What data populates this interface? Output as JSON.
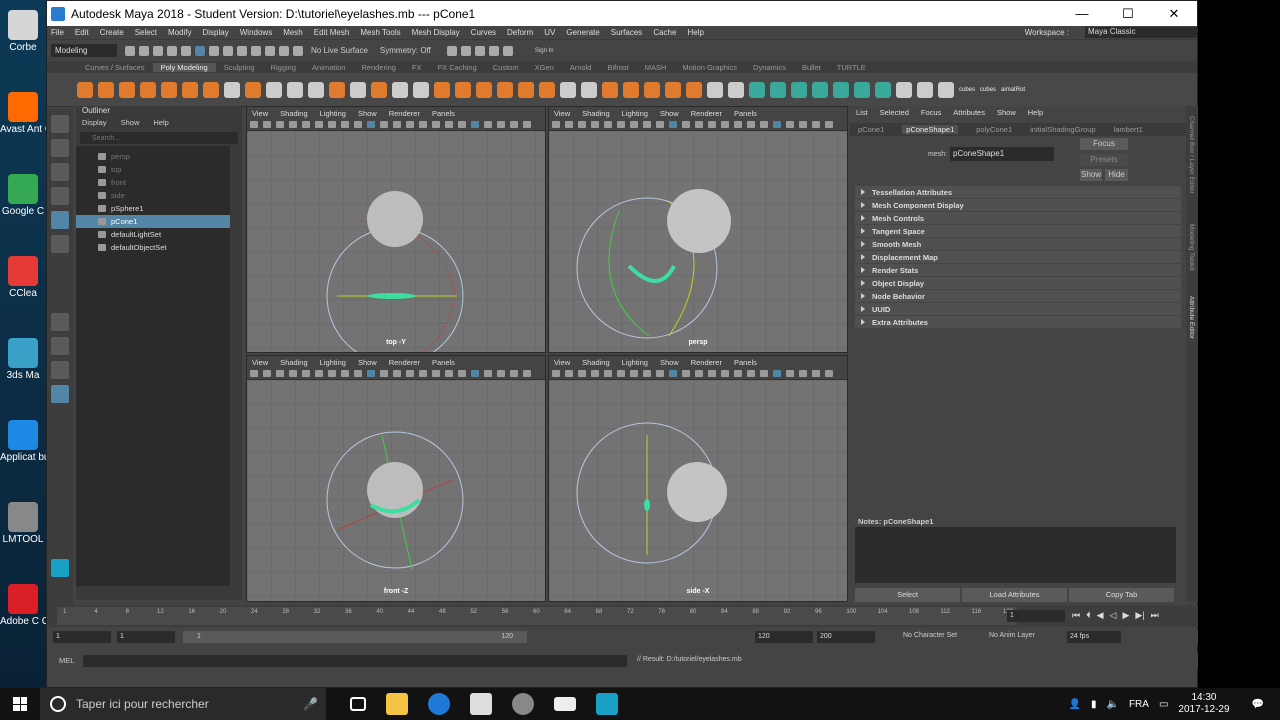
{
  "desktop_icons": [
    {
      "label": "Corbe",
      "color": "#d6d6d6"
    },
    {
      "label": "Avast Ant Grat",
      "color": "#ff6a00"
    },
    {
      "label": "Google C",
      "color": "#34a853"
    },
    {
      "label": "CClea",
      "color": "#e53935"
    },
    {
      "label": "3ds Ma",
      "color": "#3aa0c8"
    },
    {
      "label": "Applicat bureau A",
      "color": "#1e88e5"
    },
    {
      "label": "LMTOOL",
      "color": "#888888"
    },
    {
      "label": "Adobe C Clo",
      "color": "#da1f26"
    }
  ],
  "window": {
    "title": "Autodesk Maya 2018 - Student Version: D:\\tutoriel\\eyelashes.mb   ---   pCone1",
    "minimize": "—",
    "maximize": "☐",
    "close": "✕"
  },
  "menus": [
    "File",
    "Edit",
    "Create",
    "Select",
    "Modify",
    "Display",
    "Windows",
    "Mesh",
    "Edit Mesh",
    "Mesh Tools",
    "Mesh Display",
    "Curves",
    "Deform",
    "UV",
    "Generate",
    "Surfaces",
    "Cache",
    "Help"
  ],
  "workspace": {
    "label": "Workspace :",
    "value": "Maya Classic"
  },
  "status": {
    "mode": "Modeling",
    "live_surface": "No Live Surface",
    "symmetry": "Symmetry: Off",
    "signin": "Sign In"
  },
  "shelf_tabs": [
    "Curves / Surfaces",
    "Poly Modeling",
    "Sculpting",
    "Rigging",
    "Animation",
    "Rendering",
    "FX",
    "FX Caching",
    "Custom",
    "XGen",
    "Arnold",
    "Bifrost",
    "MASH",
    "Motion Graphics",
    "Dynamics",
    "Bullet",
    "TURTLE"
  ],
  "shelf_active": "Poly Modeling",
  "shelf_right_labels": [
    "cubes",
    "cubes",
    "aimatRot"
  ],
  "outliner": {
    "title": "Outliner",
    "menu": [
      "Display",
      "Show",
      "Help"
    ],
    "search_placeholder": "Search...",
    "items": [
      {
        "label": "persp",
        "state": "dim"
      },
      {
        "label": "top",
        "state": "dim"
      },
      {
        "label": "front",
        "state": "dim"
      },
      {
        "label": "side",
        "state": "dim"
      },
      {
        "label": "pSphere1",
        "state": "normal"
      },
      {
        "label": "pCone1",
        "state": "selected"
      },
      {
        "label": "defaultLightSet",
        "state": "normal"
      },
      {
        "label": "defaultObjectSet",
        "state": "normal"
      }
    ]
  },
  "viewport_menu": [
    "View",
    "Shading",
    "Lighting",
    "Show",
    "Renderer",
    "Panels"
  ],
  "viewports": [
    {
      "name": "viewport-top",
      "label": "top -Y"
    },
    {
      "name": "viewport-persp",
      "label": "persp"
    },
    {
      "name": "viewport-front",
      "label": "front -Z"
    },
    {
      "name": "viewport-side",
      "label": "side -X"
    }
  ],
  "attribute_editor": {
    "menu": [
      "List",
      "Selected",
      "Focus",
      "Attributes",
      "Show",
      "Help"
    ],
    "tabs": [
      "pCone1",
      "pConeShape1",
      "polyCone1",
      "initialShadingGroup",
      "lambert1"
    ],
    "active_tab": "pConeShape1",
    "mesh_label": "mesh:",
    "mesh_value": "pConeShape1",
    "focus": "Focus",
    "presets": "Presets",
    "show": "Show",
    "hide": "Hide",
    "sections": [
      "Tessellation Attributes",
      "Mesh Component Display",
      "Mesh Controls",
      "Tangent Space",
      "Smooth Mesh",
      "Displacement Map",
      "Render Stats",
      "Object Display",
      "Node Behavior",
      "UUID",
      "Extra Attributes"
    ],
    "notes_label": "Notes:  pConeShape1",
    "buttons": [
      "Select",
      "Load Attributes",
      "Copy Tab"
    ]
  },
  "side_tabs": [
    "Channel Box / Layer Editor",
    "Modeling Toolkit",
    "Attribute Editor"
  ],
  "timeline": {
    "ticks": [
      "1",
      "4",
      "8",
      "12",
      "16",
      "20",
      "24",
      "28",
      "32",
      "36",
      "40",
      "44",
      "48",
      "52",
      "56",
      "60",
      "64",
      "68",
      "72",
      "76",
      "80",
      "84",
      "88",
      "92",
      "96",
      "100",
      "104",
      "108",
      "112",
      "116",
      "120"
    ],
    "current": "1"
  },
  "range": {
    "start": "1",
    "anim_start": "1",
    "slider_start": "1",
    "slider_end": "120",
    "end": "120",
    "anim_end": "200",
    "character": "No Character Set",
    "anim_layer": "No Anim Layer",
    "fps": "24 fps"
  },
  "command": {
    "lang": "MEL",
    "result": "// Result: D:/tutoriel/eyelashes.mb"
  },
  "taskbar": {
    "search_placeholder": "Taper ici pour rechercher",
    "lang": "FRA",
    "time": "14:30",
    "date": "2017-12-29"
  }
}
